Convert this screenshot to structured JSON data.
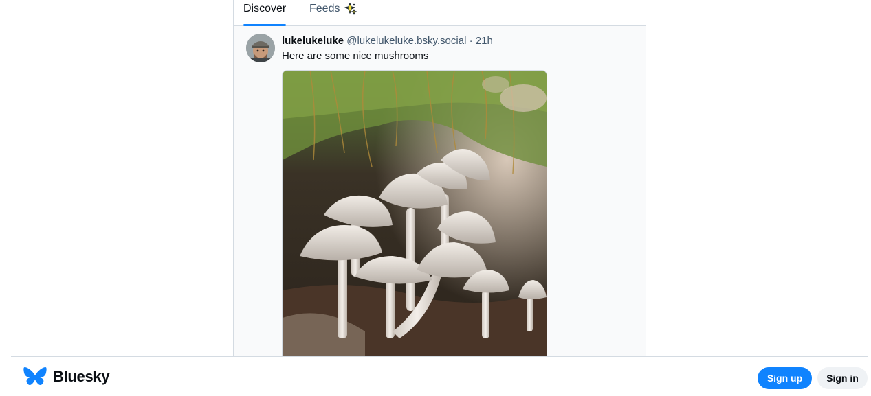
{
  "tabs": {
    "discover": "Discover",
    "feeds": "Feeds"
  },
  "post": {
    "display_name": "lukelukeluke",
    "handle": "@lukelukeluke.bsky.social",
    "separator": "·",
    "time": "21h",
    "text": "Here are some nice mushrooms",
    "avatar_icon": "user-avatar",
    "image_icon": "mushrooms-photo"
  },
  "bottom_bar": {
    "brand": "Bluesky",
    "logo_icon": "butterfly-icon",
    "signup_label": "Sign up",
    "signin_label": "Sign in"
  },
  "colors": {
    "accent": "#1083fe",
    "border": "#d4dbe2",
    "muted_text": "#42576c"
  }
}
